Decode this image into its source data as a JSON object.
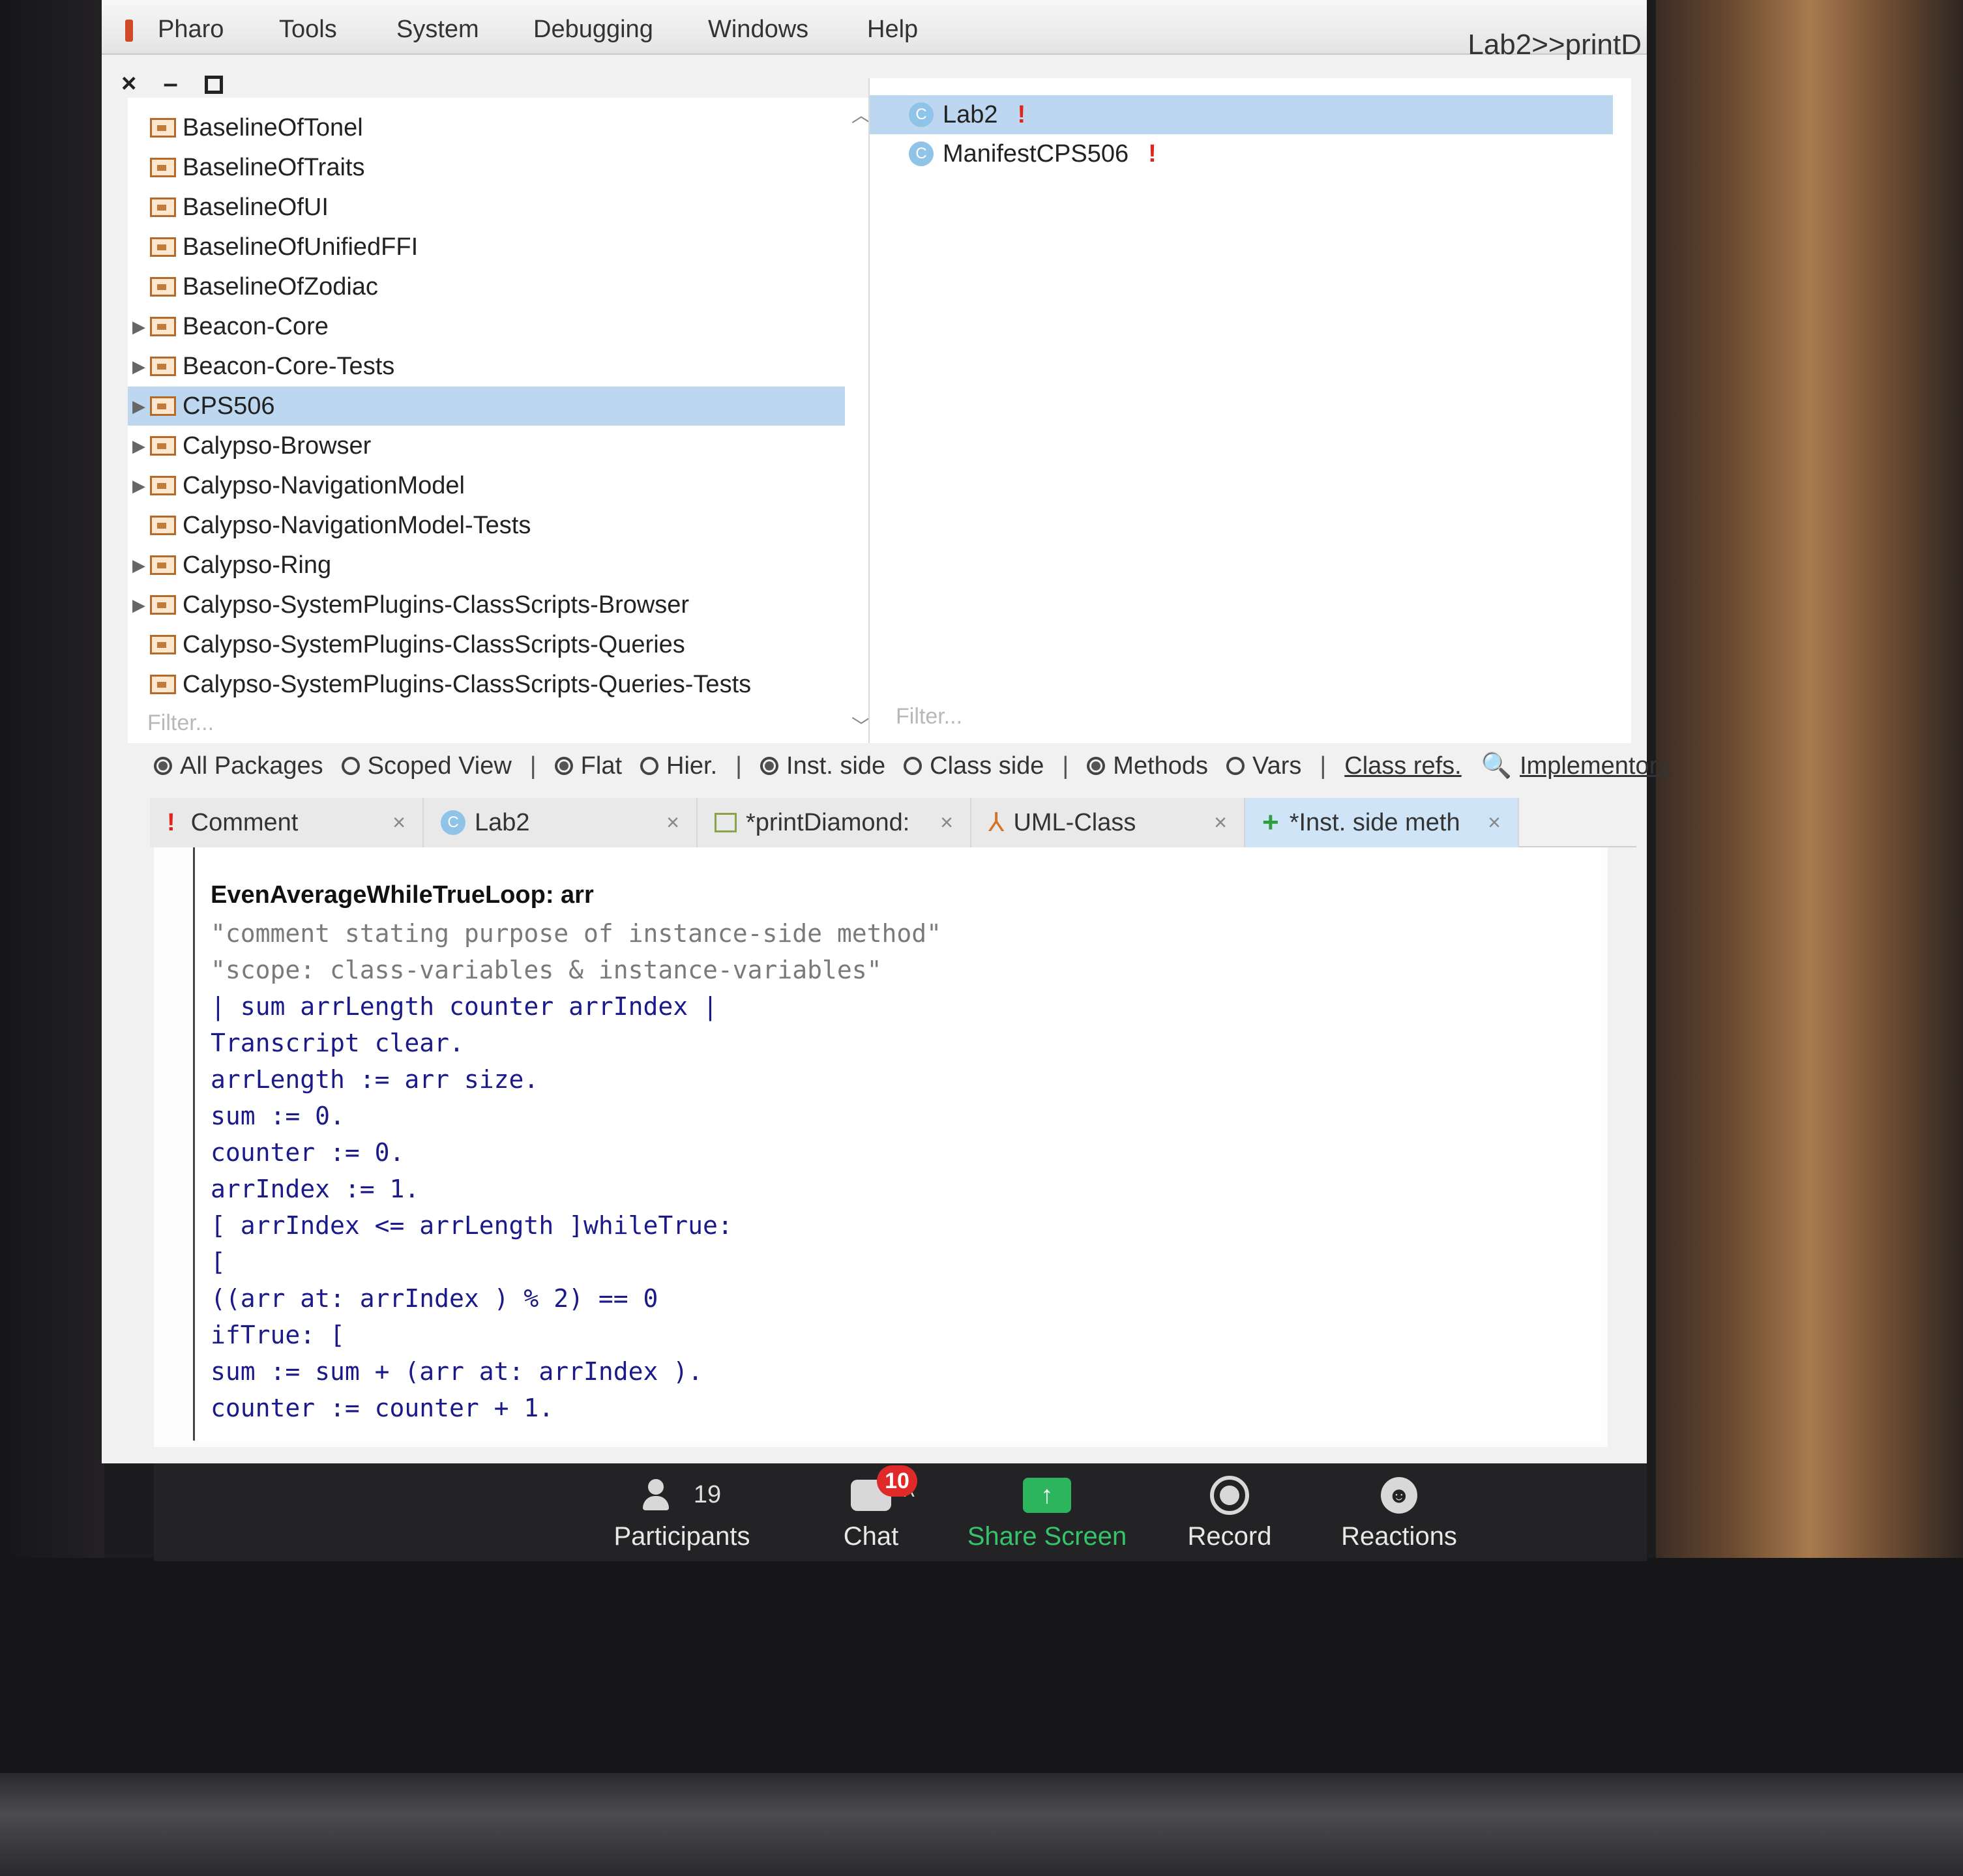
{
  "menu": {
    "items": [
      "Pharo",
      "Tools",
      "System",
      "Debugging",
      "Windows",
      "Help"
    ],
    "window_title": "Lab2>>printD"
  },
  "window_controls": {
    "close": "×",
    "minimize": "–"
  },
  "packages": {
    "items": [
      {
        "name": "BaselineOfTonel",
        "expandable": false,
        "selected": false
      },
      {
        "name": "BaselineOfTraits",
        "expandable": false,
        "selected": false
      },
      {
        "name": "BaselineOfUI",
        "expandable": false,
        "selected": false
      },
      {
        "name": "BaselineOfUnifiedFFI",
        "expandable": false,
        "selected": false
      },
      {
        "name": "BaselineOfZodiac",
        "expandable": false,
        "selected": false
      },
      {
        "name": "Beacon-Core",
        "expandable": true,
        "selected": false
      },
      {
        "name": "Beacon-Core-Tests",
        "expandable": true,
        "selected": false
      },
      {
        "name": "CPS506",
        "expandable": true,
        "selected": true
      },
      {
        "name": "Calypso-Browser",
        "expandable": true,
        "selected": false
      },
      {
        "name": "Calypso-NavigationModel",
        "expandable": true,
        "selected": false
      },
      {
        "name": "Calypso-NavigationModel-Tests",
        "expandable": false,
        "selected": false
      },
      {
        "name": "Calypso-Ring",
        "expandable": true,
        "selected": false
      },
      {
        "name": "Calypso-SystemPlugins-ClassScripts-Browser",
        "expandable": true,
        "selected": false
      },
      {
        "name": "Calypso-SystemPlugins-ClassScripts-Queries",
        "expandable": false,
        "selected": false
      },
      {
        "name": "Calypso-SystemPlugins-ClassScripts-Queries-Tests",
        "expandable": false,
        "selected": false
      }
    ],
    "filter_placeholder": "Filter..."
  },
  "classes": {
    "items": [
      {
        "name": "Lab2",
        "icon": "C",
        "warning": "!",
        "selected": true
      },
      {
        "name": "ManifestCPS506",
        "icon": "C",
        "warning": "!",
        "selected": false
      }
    ],
    "filter_placeholder": "Filter..."
  },
  "toolbar": {
    "all_packages": "All Packages",
    "scoped_view": "Scoped View",
    "flat": "Flat",
    "hier": "Hier.",
    "inst_side": "Inst. side",
    "class_side": "Class side",
    "methods": "Methods",
    "vars": "Vars",
    "class_refs": "Class refs.",
    "implementors": "Implementors",
    "separator": "|"
  },
  "tabs": [
    {
      "label": "Comment",
      "icon": "!",
      "active": false
    },
    {
      "label": "Lab2",
      "icon": "C",
      "active": false
    },
    {
      "label": "*printDiamond:",
      "icon": "method",
      "active": false
    },
    {
      "label": "UML-Class",
      "icon": "uml",
      "active": false
    },
    {
      "label": "*Inst. side meth",
      "icon": "+",
      "active": true
    }
  ],
  "tab_close": "×",
  "code": {
    "lines": [
      "EvenAverageWhileTrueLoop: arr",
      "\"comment stating purpose of instance-side method\"",
      "\"scope: class-variables & instance-variables\"",
      "| sum arrLength counter arrIndex |",
      "Transcript clear.",
      "arrLength := arr size.",
      "sum := 0.",
      "counter := 0.",
      "arrIndex := 1.",
      "[ arrIndex <= arrLength ]whileTrue:",
      "[",
      "((arr at: arrIndex ) % 2) == 0",
      "ifTrue: [",
      "sum := sum + (arr at: arrIndex ).",
      "counter := counter + 1."
    ]
  },
  "zoom": {
    "participants_count": "19",
    "participants_label": "Participants",
    "caret": "^",
    "chat_badge": "10",
    "chat_label": "Chat",
    "share_label": "Share Screen",
    "share_icon": "↑",
    "record_label": "Record",
    "reactions_label": "Reactions",
    "reactions_icon": "☻",
    "share_color": "#2db55d"
  }
}
